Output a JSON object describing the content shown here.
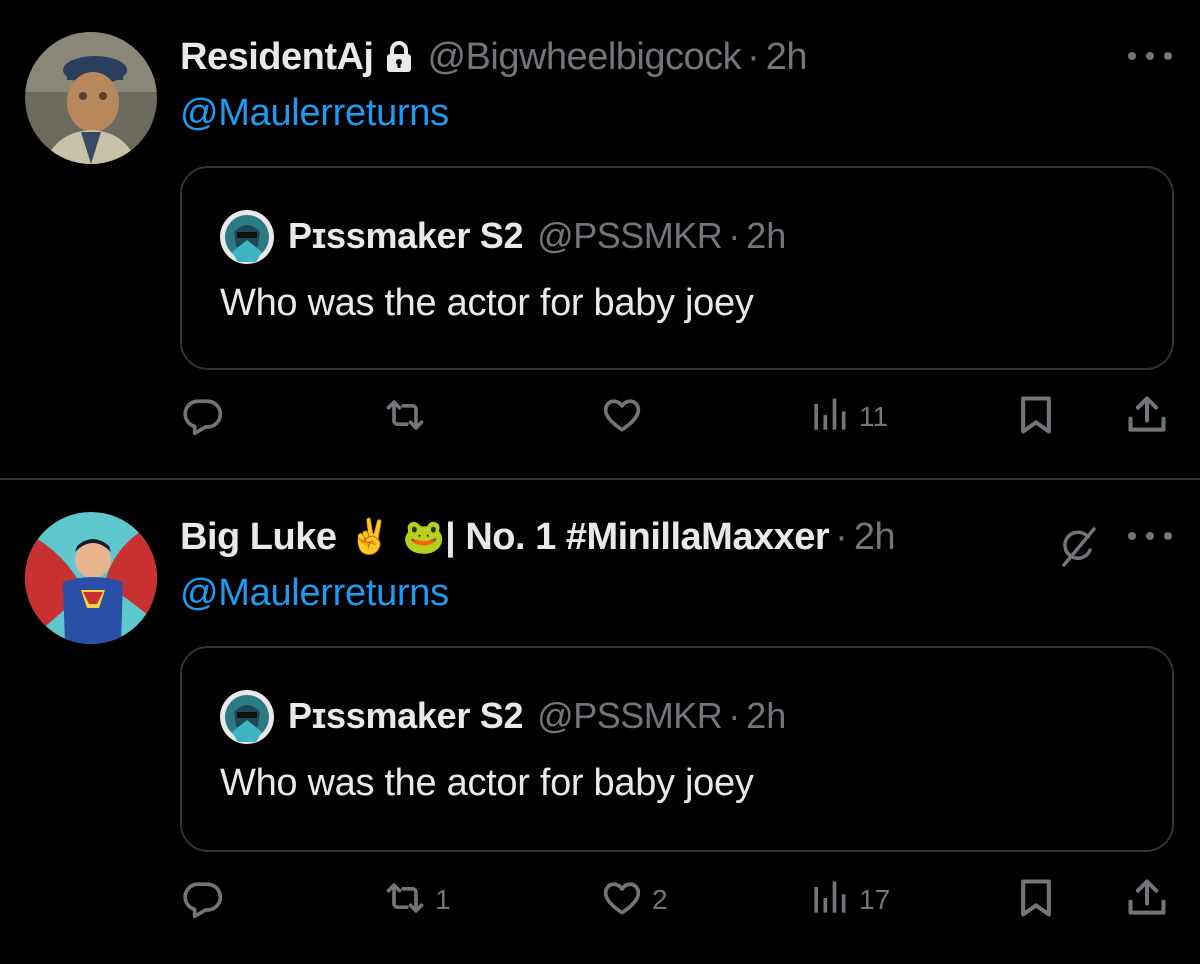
{
  "tweets": [
    {
      "display_name": "ResidentAj",
      "handle": "@Bigwheelbigcock",
      "separator": "·",
      "time": "2h",
      "replying_to": "@Maulerreturns",
      "protected": true,
      "quote": {
        "display_name": "Pɪssmaker S2",
        "handle": "@PSSMKR",
        "separator": "·",
        "time": "2h",
        "text": "Who was the actor for baby joey"
      },
      "actions": {
        "reply": "",
        "retweet": "",
        "like": "",
        "views": "11"
      }
    },
    {
      "display_name": "Big Luke",
      "emoji_1": "✌️",
      "emoji_2": "🐸",
      "name_suffix": "| No. 1 #MinillaMaxxer",
      "separator": "·",
      "time": "2h",
      "replying_to": "@Maulerreturns",
      "quote": {
        "display_name": "Pɪssmaker S2",
        "handle": "@PSSMKR",
        "separator": "·",
        "time": "2h",
        "text": "Who was the actor for baby joey"
      },
      "actions": {
        "reply": "",
        "retweet": "1",
        "like": "2",
        "views": "17"
      }
    }
  ],
  "colors": {
    "background": "#000000",
    "text_primary": "#e7e9ea",
    "text_secondary": "#71767b",
    "link": "#1d9bf0",
    "border": "#2f3336"
  },
  "icons": [
    "reply-icon",
    "retweet-icon",
    "like-icon",
    "views-icon",
    "bookmark-icon",
    "share-icon",
    "lock-icon",
    "more-icon",
    "grok-icon"
  ]
}
